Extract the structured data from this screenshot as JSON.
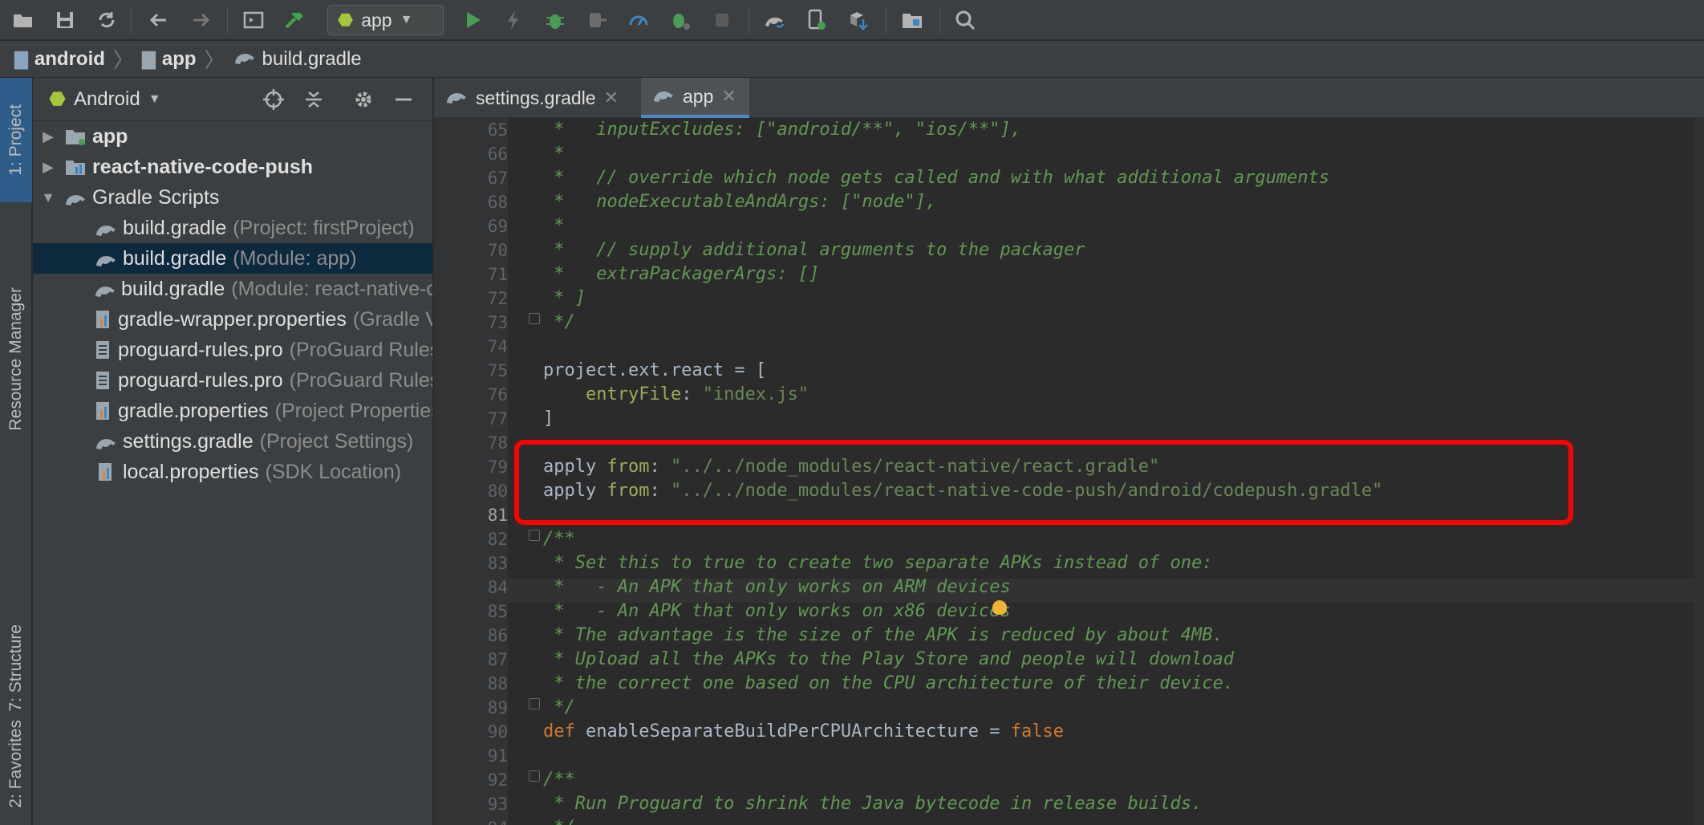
{
  "toolbar": {
    "run_config": "app",
    "icons": [
      "open-icon",
      "save-icon",
      "sync-icon",
      "back-icon",
      "forward-icon",
      "layout-icon",
      "build-hammer-icon",
      "run-icon",
      "apply-changes-icon",
      "debug-icon",
      "attach-debugger-icon",
      "profile-icon",
      "debug-bug-icon",
      "stop-icon",
      "gradle-sync-icon",
      "avd-manager-icon",
      "sdk-manager-icon",
      "project-structure-icon",
      "search-icon"
    ]
  },
  "breadcrumb": {
    "items": [
      "android",
      "app",
      "build.gradle"
    ]
  },
  "left_strip": {
    "tabs": [
      "1: Project",
      "Resource Manager",
      "7: Structure",
      "2: Favorites"
    ]
  },
  "project_panel": {
    "view": "Android",
    "tree": [
      {
        "label": "app",
        "hint": "",
        "bold": true
      },
      {
        "label": "react-native-code-push",
        "hint": "",
        "bold": true
      },
      {
        "label": "Gradle Scripts",
        "hint": ""
      },
      {
        "label": "build.gradle",
        "hint": "(Project: firstProject)"
      },
      {
        "label": "build.gradle",
        "hint": "(Module: app)"
      },
      {
        "label": "build.gradle",
        "hint": "(Module: react-native-code-push)"
      },
      {
        "label": "gradle-wrapper.properties",
        "hint": "(Gradle Version)"
      },
      {
        "label": "proguard-rules.pro",
        "hint": "(ProGuard Rules for app)"
      },
      {
        "label": "proguard-rules.pro",
        "hint": "(ProGuard Rules for react-native-code-push)"
      },
      {
        "label": "gradle.properties",
        "hint": "(Project Properties)"
      },
      {
        "label": "settings.gradle",
        "hint": "(Project Settings)"
      },
      {
        "label": "local.properties",
        "hint": "(SDK Location)"
      }
    ]
  },
  "editor": {
    "tabs": [
      "settings.gradle",
      "app"
    ],
    "line_numbers": [
      "65",
      "66",
      "67",
      "68",
      "69",
      "70",
      "71",
      "72",
      "73",
      "74",
      "75",
      "76",
      "77",
      "78",
      "79",
      "80",
      "81",
      "82",
      "83",
      "84",
      "85",
      "86",
      "87",
      "88",
      "89",
      "90",
      "91",
      "92",
      "93",
      "94"
    ],
    "lines": {
      "l65": " *   inputExcludes: [\"android/**\", \"ios/**\"],",
      "l66": " *",
      "l67": " *   // override which node gets called and with what additional arguments",
      "l68": " *   nodeExecutableAndArgs: [\"node\"],",
      "l69": " *",
      "l70": " *   // supply additional arguments to the packager",
      "l71": " *   extraPackagerArgs: []",
      "l72": " * ]",
      "l73": " */",
      "l75a": "project.ext.react = [",
      "l76a": "    entryFile",
      "l76b": ": ",
      "l76c": "\"index.js\"",
      "l77": "]",
      "l79a": "apply ",
      "l79b": "from",
      "l79c": ": ",
      "l79d": "\"../../node_modules/react-native/react.gradle\"",
      "l80a": "apply ",
      "l80b": "from",
      "l80c": ": ",
      "l80d": "\"../../node_modules/react-native-code-push/android/codepush.gradle\"",
      "l82": "/**",
      "l83": " * Set this to true to create two separate APKs instead of one:",
      "l84": " *   - An APK that only works on ARM devices",
      "l85": " *   - An APK that only works on x86 devices",
      "l86": " * The advantage is the size of the APK is reduced by about 4MB.",
      "l87": " * Upload all the APKs to the Play Store and people will download",
      "l88": " * the correct one based on the CPU architecture of their device.",
      "l89": " */",
      "l90a": "def ",
      "l90b": "enableSeparateBuildPerCPUArchitecture = ",
      "l90c": "false",
      "l92": "/**",
      "l93": " * Run Proguard to shrink the Java bytecode in release builds.",
      "l94": " */"
    }
  }
}
